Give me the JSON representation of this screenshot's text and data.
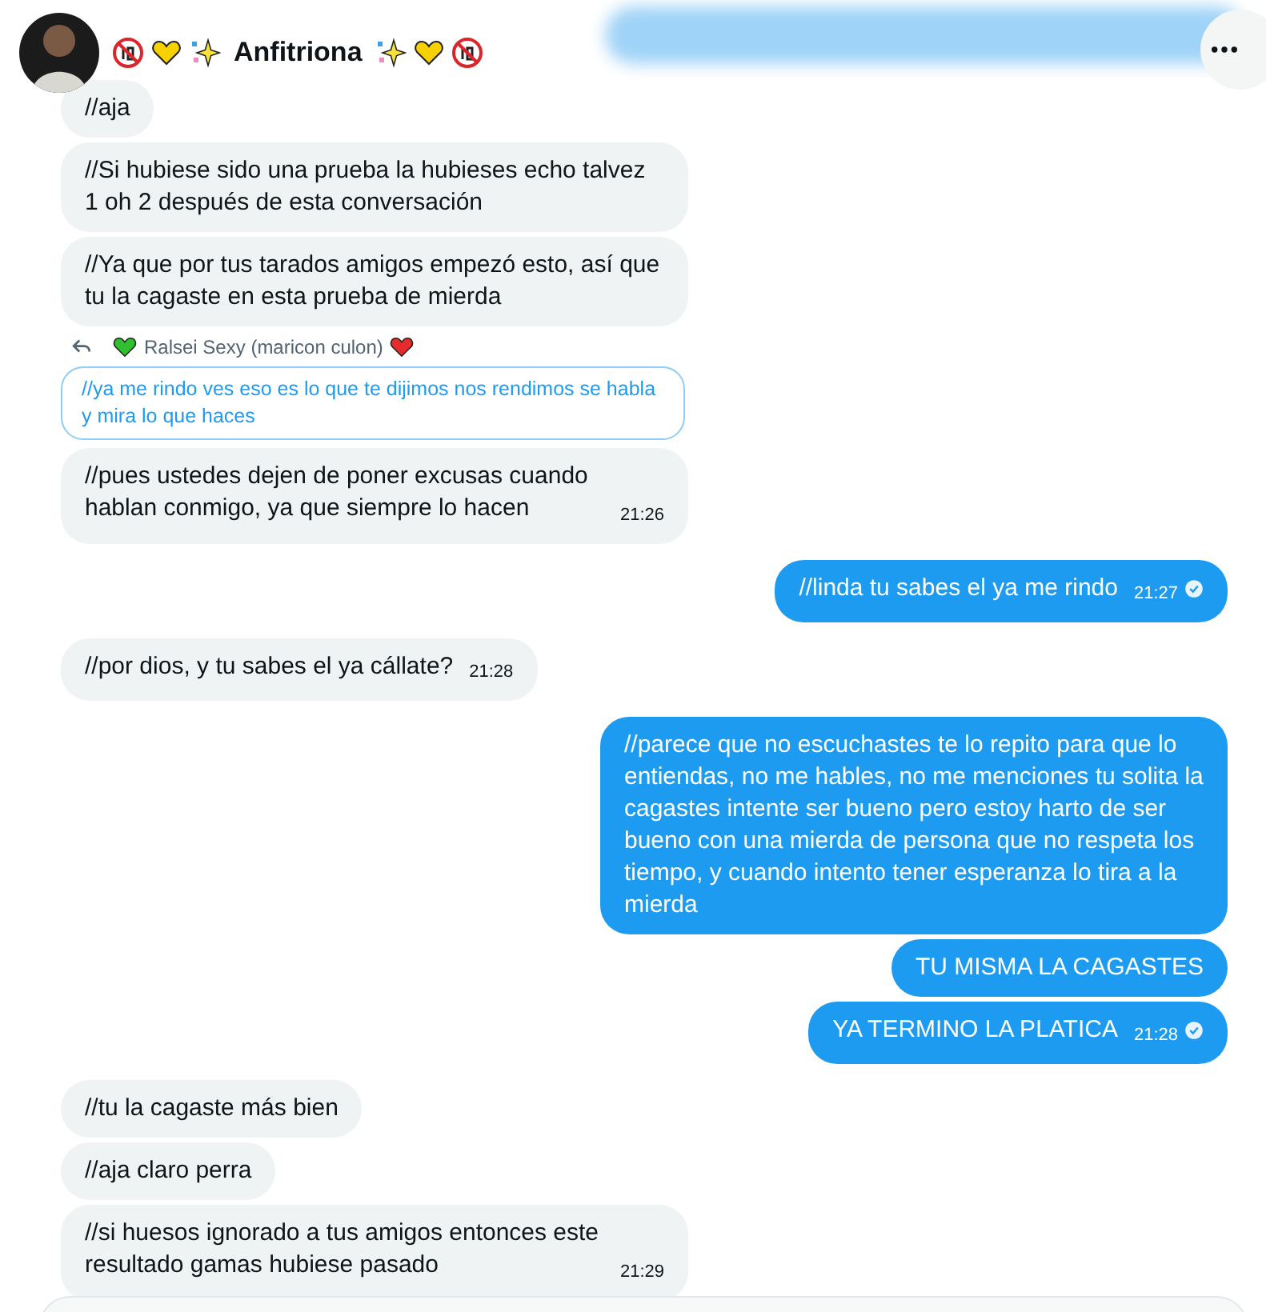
{
  "header": {
    "name": "Anfitriona"
  },
  "messages": [
    {
      "kind": "received",
      "text": "//aja"
    },
    {
      "kind": "received",
      "text": "//Si hubiese sido una prueba la hubieses echo talvez 1 oh 2 después de esta conversación"
    },
    {
      "kind": "received",
      "text": "//Ya que por tus tarados amigos empezó esto, así que tu la cagaste en esta prueba de mierda"
    },
    {
      "kind": "received",
      "reply": {
        "author": "Ralsei Sexy (maricon culon)",
        "text": "//ya me rindo ves eso es lo que te dijimos nos rendimos se habla y mira lo que haces"
      },
      "text": "//pues ustedes dejen de poner excusas cuando hablan conmigo, ya que siempre lo hacen",
      "time": "21:26"
    },
    {
      "kind": "sent",
      "text": "//linda tu sabes el ya me rindo",
      "time": "21:27",
      "seen": true
    },
    {
      "kind": "received",
      "text": "//por dios, y tu sabes el ya cállate?",
      "time": "21:28"
    },
    {
      "kind": "sent",
      "text": "//parece que no escuchastes te lo repito para que lo entiendas, no me hables, no me menciones tu solita la cagastes intente ser bueno pero estoy harto de ser bueno con una mierda de persona que no respeta los tiempo, y cuando intento tener esperanza lo tira a la mierda"
    },
    {
      "kind": "sent",
      "text": "TU MISMA LA CAGASTES"
    },
    {
      "kind": "sent",
      "text": "YA TERMINO LA PLATICA",
      "time": "21:28",
      "seen": true
    },
    {
      "kind": "received",
      "text": "//tu la cagaste más bien"
    },
    {
      "kind": "received",
      "text": "//aja claro perra"
    },
    {
      "kind": "received",
      "text": "//si huesos ignorado a tus amigos entonces este resultado gamas hubiese pasado",
      "time": "21:29"
    }
  ]
}
